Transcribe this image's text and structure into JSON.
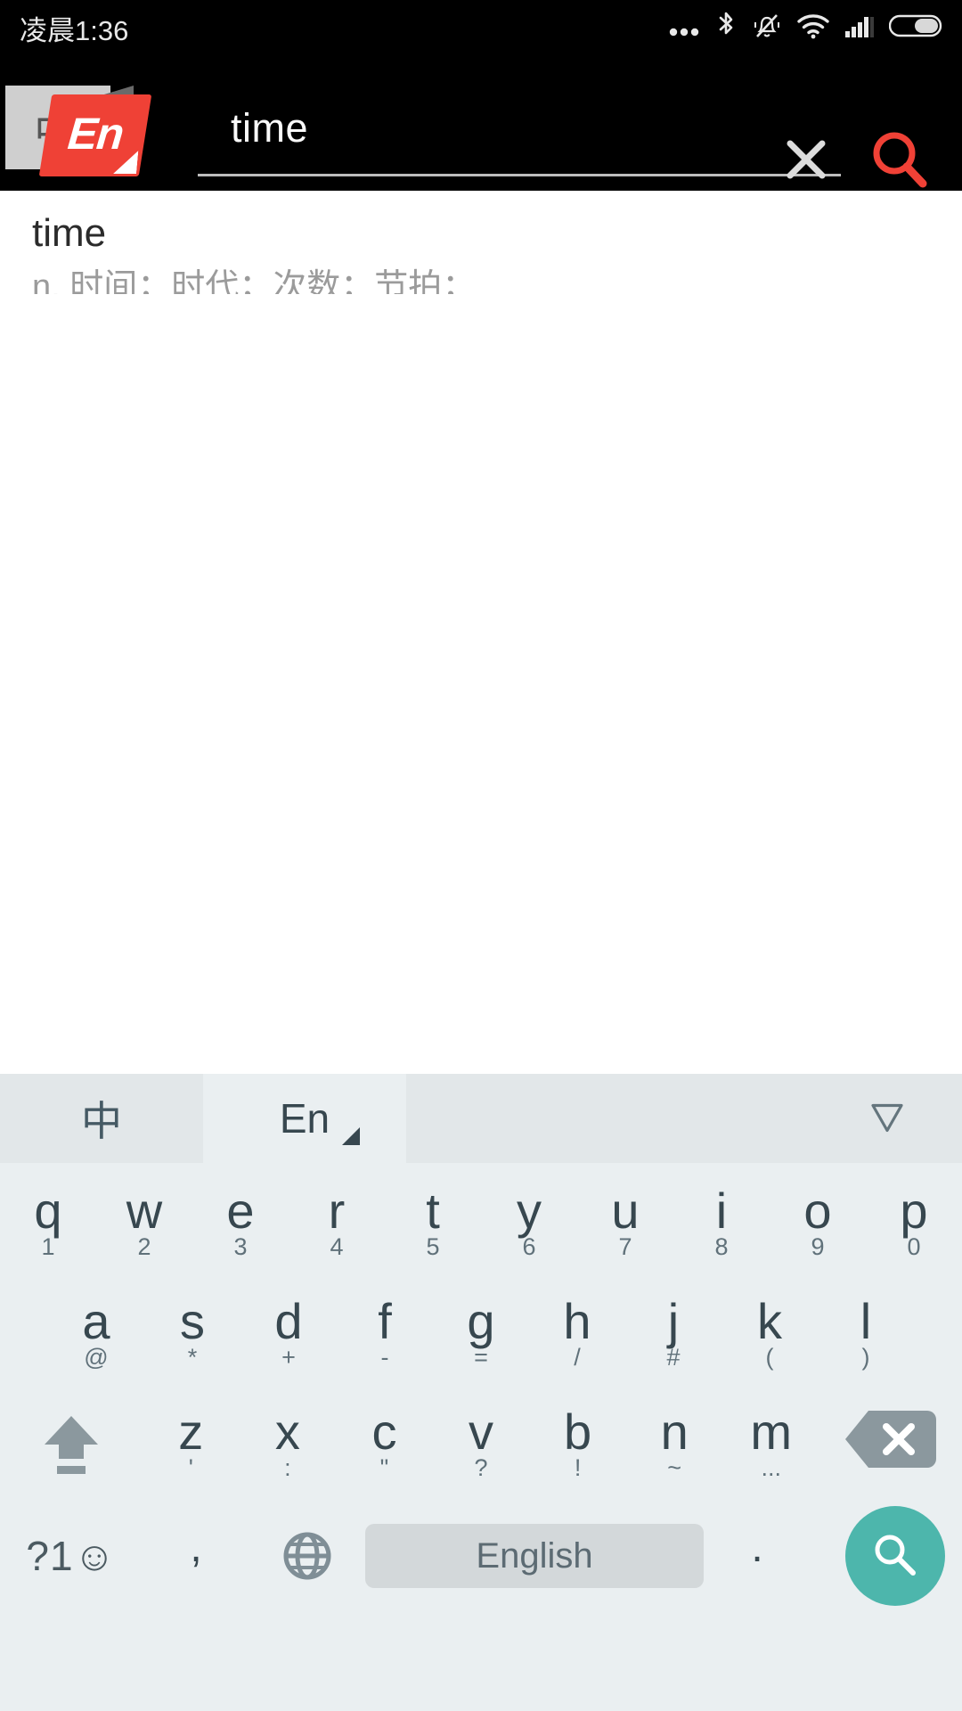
{
  "status_bar": {
    "time": "凌晨1:36",
    "icons": [
      "more-dots-icon",
      "bluetooth-icon",
      "mute-bell-icon",
      "wifi-icon",
      "signal-icon",
      "battery-icon"
    ]
  },
  "app_bar": {
    "logo": {
      "back_label": "中",
      "front_label": "En",
      "front_color": "#ef4136",
      "back_color": "#cfcfcf"
    },
    "search_input": {
      "value": "time",
      "placeholder": "",
      "clear_icon": "close-icon",
      "search_icon": "search-icon",
      "search_icon_color": "#ef4136"
    },
    "background": "#000000"
  },
  "results": [
    {
      "word": "time",
      "definition": "n. 时间；时代；次数；节拍；"
    }
  ],
  "keyboard": {
    "toolbar": {
      "tab_zh": "中",
      "tab_en": "En",
      "selected_tab": "En",
      "collapse_icon": "collapse-down-icon"
    },
    "row1": [
      {
        "letter": "q",
        "sub": "1"
      },
      {
        "letter": "w",
        "sub": "2"
      },
      {
        "letter": "e",
        "sub": "3"
      },
      {
        "letter": "r",
        "sub": "4"
      },
      {
        "letter": "t",
        "sub": "5"
      },
      {
        "letter": "y",
        "sub": "6"
      },
      {
        "letter": "u",
        "sub": "7"
      },
      {
        "letter": "i",
        "sub": "8"
      },
      {
        "letter": "o",
        "sub": "9"
      },
      {
        "letter": "p",
        "sub": "0"
      }
    ],
    "row2": [
      {
        "letter": "a",
        "sub": "@"
      },
      {
        "letter": "s",
        "sub": "*"
      },
      {
        "letter": "d",
        "sub": "+"
      },
      {
        "letter": "f",
        "sub": "-"
      },
      {
        "letter": "g",
        "sub": "="
      },
      {
        "letter": "h",
        "sub": "/"
      },
      {
        "letter": "j",
        "sub": "#"
      },
      {
        "letter": "k",
        "sub": "("
      },
      {
        "letter": "l",
        "sub": ")"
      }
    ],
    "row3": [
      {
        "letter": "z",
        "sub": "'"
      },
      {
        "letter": "x",
        "sub": ":"
      },
      {
        "letter": "c",
        "sub": "\""
      },
      {
        "letter": "v",
        "sub": "?"
      },
      {
        "letter": "b",
        "sub": "!"
      },
      {
        "letter": "n",
        "sub": "~"
      },
      {
        "letter": "m",
        "sub": "..."
      }
    ],
    "shift_icon": "shift-arrow-icon",
    "backspace_icon": "backspace-icon",
    "row4": {
      "symbol_key": "?1☺",
      "comma_key": ",",
      "globe_icon": "globe-icon",
      "space_label": "English",
      "period_key": ".",
      "enter_icon": "search-icon",
      "enter_color": "#4db6ac"
    }
  }
}
